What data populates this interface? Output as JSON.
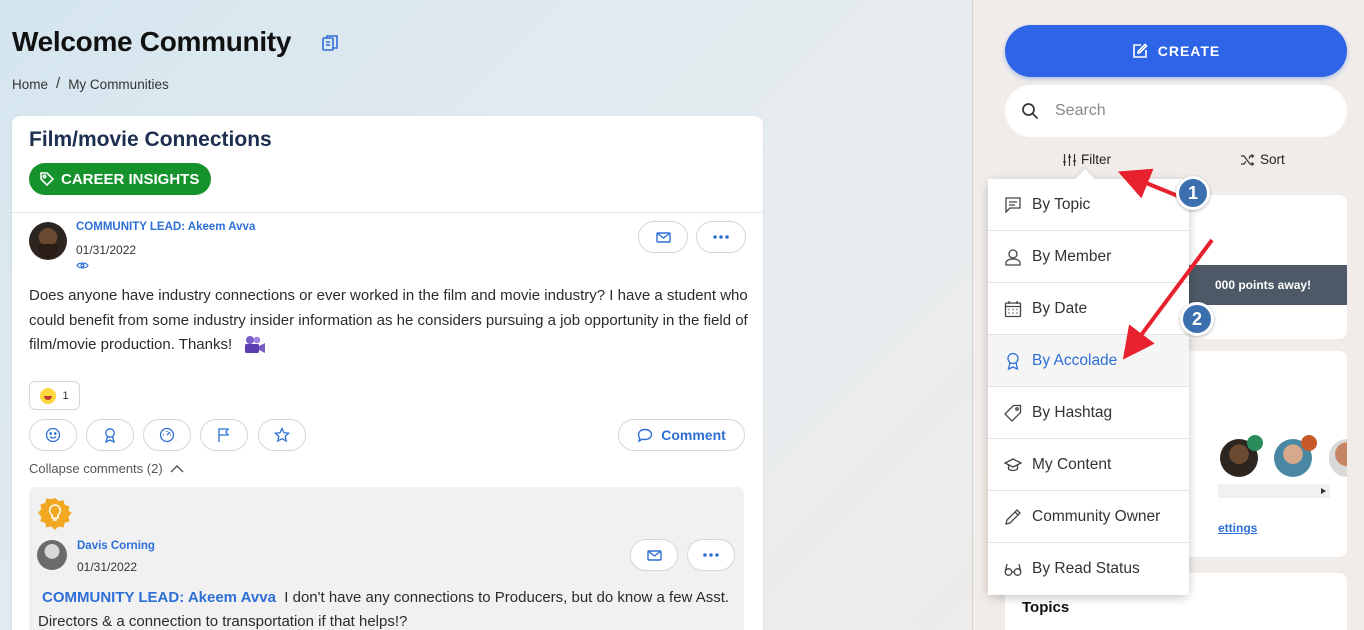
{
  "header": {
    "title": "Welcome Community",
    "breadcrumb": [
      "Home",
      "My Communities"
    ]
  },
  "post": {
    "title": "Film/movie Connections",
    "tag": "CAREER INSIGHTS",
    "author": "COMMUNITY LEAD: Akeem Avva",
    "date": "01/31/2022",
    "body": "Does anyone have industry connections or ever worked in the film and movie industry? I have a student who could benefit from some industry insider information as he considers pursuing a job opportunity in the field of film/movie production. Thanks!",
    "reaction_count": "1",
    "comment_label": "Comment",
    "collapse_label": "Collapse comments (2)"
  },
  "comment": {
    "author": "Davis Corning",
    "date": "01/31/2022",
    "mention": "COMMUNITY LEAD: Akeem Avva",
    "body": "I don't have any connections to Producers, but do know a few Asst. Directors & a connection to transportation if that helps!?"
  },
  "sidebar": {
    "create_label": "CREATE",
    "search_placeholder": "Search",
    "filter_label": "Filter",
    "sort_label": "Sort",
    "points_text": "000 points away!",
    "settings_link": "ettings",
    "topics_label": "Topics"
  },
  "filter_menu": {
    "items": [
      {
        "label": "By Topic",
        "icon": "chat-icon"
      },
      {
        "label": "By Member",
        "icon": "person-icon"
      },
      {
        "label": "By Date",
        "icon": "calendar-icon"
      },
      {
        "label": "By Accolade",
        "icon": "award-icon"
      },
      {
        "label": "By Hashtag",
        "icon": "tag-icon"
      },
      {
        "label": "My Content",
        "icon": "graduation-cap-icon"
      },
      {
        "label": "Community Owner",
        "icon": "pencil-icon"
      },
      {
        "label": "By Read Status",
        "icon": "glasses-icon"
      }
    ],
    "active_index": 3
  },
  "annotations": [
    "1",
    "2"
  ],
  "colors": {
    "accent": "#2e64e6",
    "link": "#2d6fd6",
    "tag_green": "#15922c",
    "arrow_red": "#e8212e",
    "marker_blue": "#3c6fae"
  }
}
